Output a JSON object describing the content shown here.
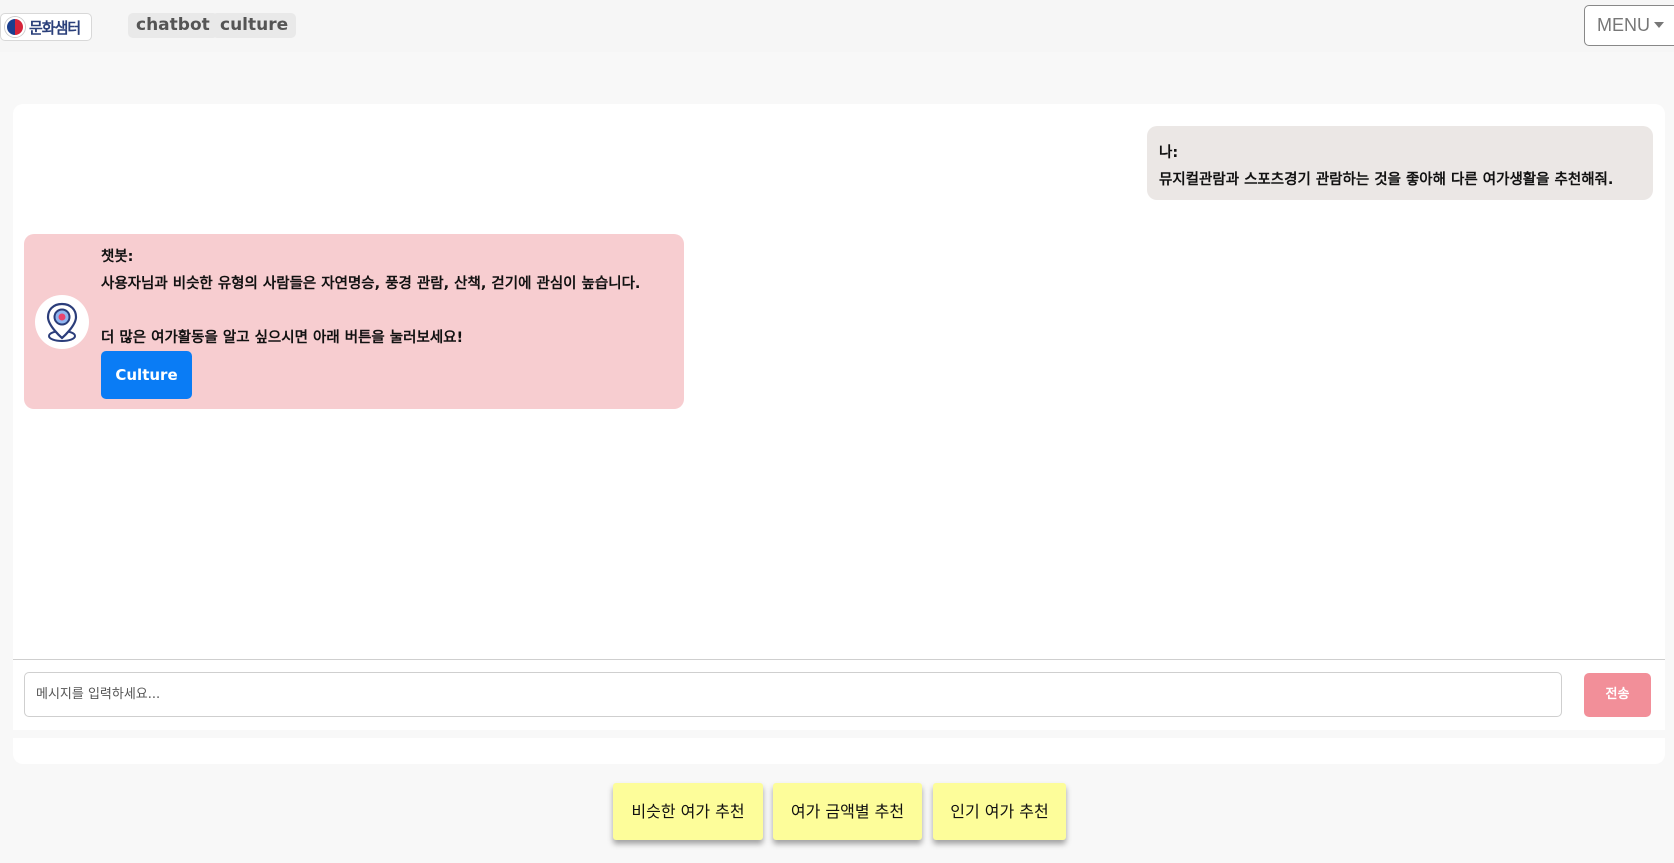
{
  "nav": {
    "logo_text": "문화샘터",
    "links": [
      "chatbot",
      "culture"
    ],
    "menu_label": "MENU"
  },
  "chat": {
    "user_message": {
      "sender": "나:",
      "text": "뮤지컬관람과 스포츠경기 관람하는 것을 좋아해 다른 여가생활을 추천해줘."
    },
    "bot_message": {
      "sender": "챗봇:",
      "line1": "사용자님과 비슷한 유형의 사람들은 자연명승, 풍경 관람, 산책, 걷기에 관심이 높습니다.",
      "line2": "더 많은 여가활동을 알고 싶으시면 아래 버튼을 눌러보세요!",
      "button_label": "Culture",
      "avatar_icon": "location-pin-icon"
    },
    "input": {
      "placeholder": "메시지를 입력하세요...",
      "value": ""
    },
    "send_label": "전송"
  },
  "recommend_buttons": [
    "비슷한 여가 추천",
    "여가 금액별 추천",
    "인기 여가 추천"
  ],
  "colors": {
    "user_bubble": "#ebe7e5",
    "bot_bubble": "#f7cdd0",
    "primary": "#0a7cf5",
    "send": "#f28f99",
    "recommend": "#fdfd9a"
  }
}
